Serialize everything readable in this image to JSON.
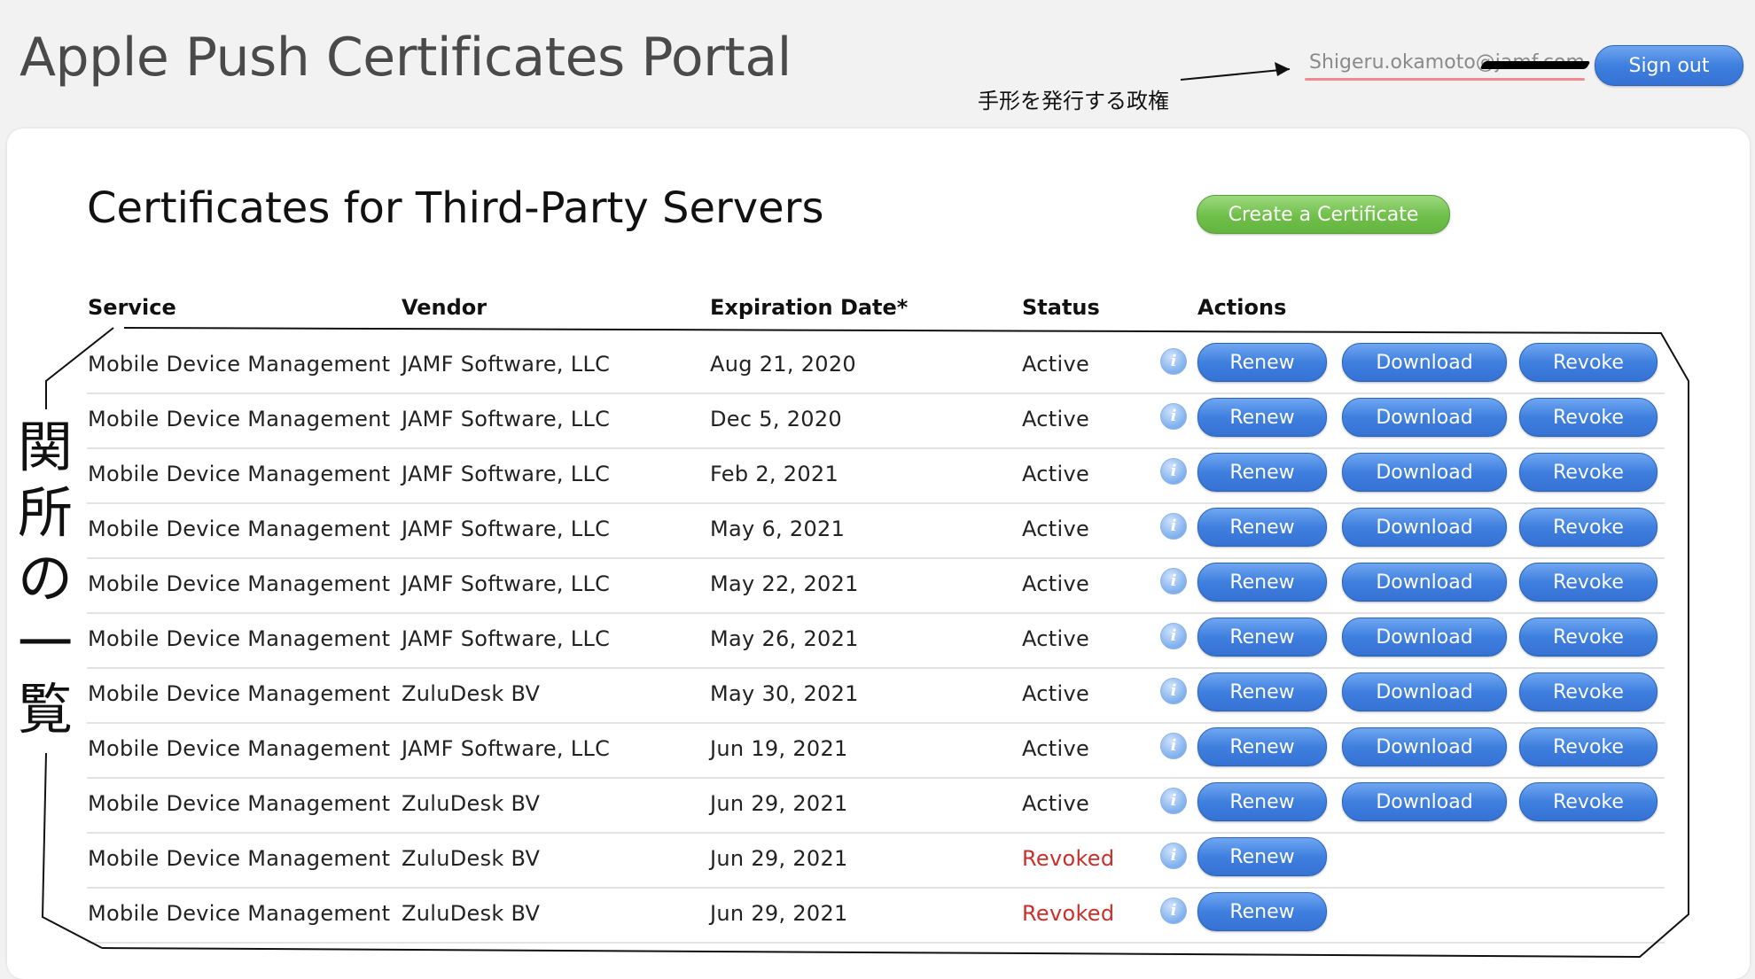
{
  "header": {
    "portal_title": "Apple Push Certificates Portal",
    "account_email": "Shigeru.okamoto@jamf.com",
    "sign_out_label": "Sign out"
  },
  "annotations": {
    "issuer_note": "手形を発行する政権",
    "list_note": [
      "関",
      "所",
      "の",
      "一",
      "覧"
    ]
  },
  "main": {
    "title": "Certificates for Third-Party Servers",
    "create_label": "Create a Certificate",
    "columns": [
      "Service",
      "Vendor",
      "Expiration Date*",
      "Status",
      "Actions"
    ],
    "info_icon_glyph": "i",
    "actions": {
      "renew": "Renew",
      "download": "Download",
      "revoke": "Revoke"
    },
    "rows": [
      {
        "service": "Mobile Device Management",
        "vendor": "JAMF Software, LLC",
        "expiration": "Aug 21, 2020",
        "status": "Active"
      },
      {
        "service": "Mobile Device Management",
        "vendor": "JAMF Software, LLC",
        "expiration": "Dec 5, 2020",
        "status": "Active"
      },
      {
        "service": "Mobile Device Management",
        "vendor": "JAMF Software, LLC",
        "expiration": "Feb 2, 2021",
        "status": "Active"
      },
      {
        "service": "Mobile Device Management",
        "vendor": "JAMF Software, LLC",
        "expiration": "May 6, 2021",
        "status": "Active"
      },
      {
        "service": "Mobile Device Management",
        "vendor": "JAMF Software, LLC",
        "expiration": "May 22, 2021",
        "status": "Active"
      },
      {
        "service": "Mobile Device Management",
        "vendor": "JAMF Software, LLC",
        "expiration": "May 26, 2021",
        "status": "Active"
      },
      {
        "service": "Mobile Device Management",
        "vendor": "ZuluDesk BV",
        "expiration": "May 30, 2021",
        "status": "Active"
      },
      {
        "service": "Mobile Device Management",
        "vendor": "JAMF Software, LLC",
        "expiration": "Jun 19, 2021",
        "status": "Active"
      },
      {
        "service": "Mobile Device Management",
        "vendor": "ZuluDesk BV",
        "expiration": "Jun 29, 2021",
        "status": "Active"
      },
      {
        "service": "Mobile Device Management",
        "vendor": "ZuluDesk BV",
        "expiration": "Jun 29, 2021",
        "status": "Revoked"
      },
      {
        "service": "Mobile Device Management",
        "vendor": "ZuluDesk BV",
        "expiration": "Jun 29, 2021",
        "status": "Revoked"
      }
    ]
  },
  "colors": {
    "button_blue": "#3f7fde",
    "button_green": "#6fbf4a",
    "revoked_red": "#c9302c"
  }
}
